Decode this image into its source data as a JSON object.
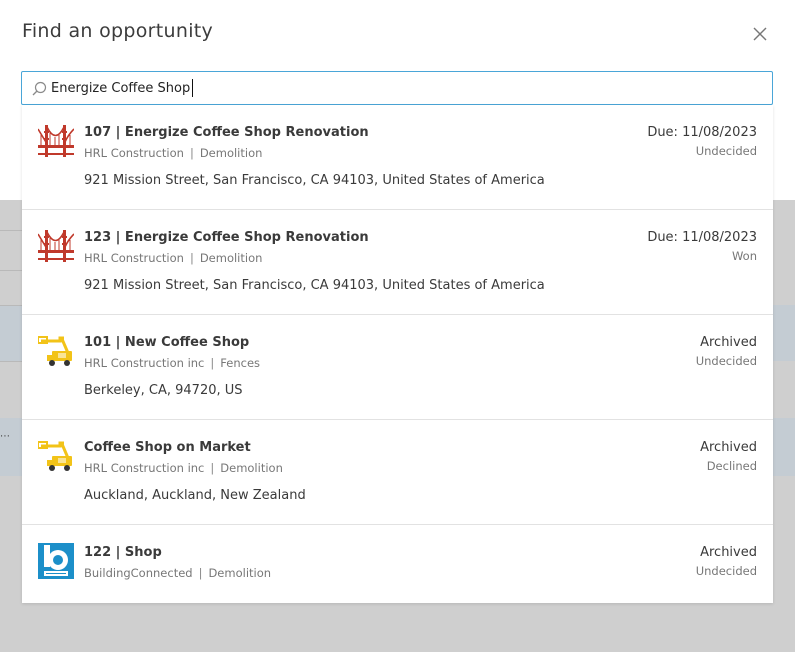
{
  "modal": {
    "title": "Find an opportunity",
    "close_icon": "close-icon"
  },
  "search": {
    "icon": "search-icon",
    "value": "Energize Coffee Shop",
    "placeholder": ""
  },
  "results": [
    {
      "name": "107 | Energize Coffee Shop Renovation",
      "company": "HRL Construction",
      "trade": "Demolition",
      "address": "921 Mission Street, San Francisco, CA 94103, United States of America",
      "due": "Due: 11/08/2023",
      "status": "Undecided",
      "logo": "golden-gate-bridge-logo"
    },
    {
      "name": "123 | Energize Coffee Shop Renovation",
      "company": "HRL Construction",
      "trade": "Demolition",
      "address": "921 Mission Street, San Francisco, CA 94103, United States of America",
      "due": "Due: 11/08/2023",
      "status": "Won",
      "logo": "golden-gate-bridge-logo"
    },
    {
      "name": "101 | New Coffee Shop",
      "company": "HRL Construction inc",
      "trade": "Fences",
      "address": "Berkeley, CA, 94720, US",
      "due": "Archived",
      "status": "Undecided",
      "logo": "boom-lift-logo"
    },
    {
      "name": "Coffee Shop on Market",
      "company": "HRL Construction inc",
      "trade": "Demolition",
      "address": "Auckland, Auckland, New Zealand",
      "due": "Archived",
      "status": "Declined",
      "logo": "boom-lift-logo"
    },
    {
      "name": "122 | Shop",
      "company": "BuildingConnected",
      "trade": "Demolition",
      "address": "",
      "due": "Archived",
      "status": "Undecided",
      "logo": "buildingconnected-logo"
    }
  ],
  "meta_separator": "|",
  "colors": {
    "accent": "#4aa6d8",
    "bridge_red": "#c0392b",
    "lift_yellow": "#f2c318",
    "bc_blue": "#1c8fc9"
  }
}
